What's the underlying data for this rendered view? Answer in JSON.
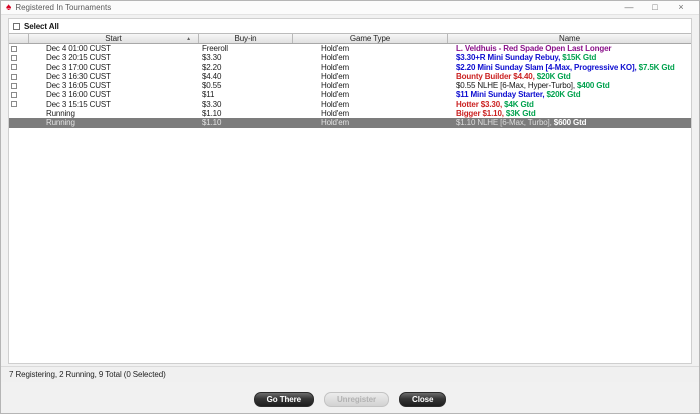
{
  "window": {
    "title": "Registered In Tournaments"
  },
  "titlebar": {
    "minimize_icon": "—",
    "maximize_icon": "□",
    "close_icon": "×",
    "app_icon": "red-spade"
  },
  "select_all": {
    "label": "Select All",
    "checked": false
  },
  "table": {
    "headers": {
      "checkbox": "",
      "start": "Start",
      "buyin": "Buy-in",
      "game_type": "Game Type",
      "name": "Name"
    },
    "sort_indicator": "▲",
    "rows": [
      {
        "checkbox": true,
        "selected": false,
        "start": "Dec 4 01:00 CUST",
        "buyin": "Freeroll",
        "game": "Hold'em",
        "name": [
          {
            "text": "L. Veldhuis - Red Spade Open Last Longer",
            "color": "purple",
            "bold": true
          }
        ]
      },
      {
        "checkbox": true,
        "selected": false,
        "start": "Dec 3 20:15 CUST",
        "buyin": "$3.30",
        "game": "Hold'em",
        "name": [
          {
            "text": "$3.30+R Mini Sunday Rebuy,",
            "color": "blue",
            "bold": true
          },
          {
            "text": " $15K Gtd",
            "color": "green",
            "bold": true
          }
        ]
      },
      {
        "checkbox": true,
        "selected": false,
        "start": "Dec 3 17:00 CUST",
        "buyin": "$2.20",
        "game": "Hold'em",
        "name": [
          {
            "text": "$2.20 Mini Sunday Slam [4-Max, Progressive KO],",
            "color": "blue",
            "bold": true
          },
          {
            "text": " $7.5K Gtd",
            "color": "green",
            "bold": true
          }
        ]
      },
      {
        "checkbox": true,
        "selected": false,
        "start": "Dec 3 16:30 CUST",
        "buyin": "$4.40",
        "game": "Hold'em",
        "name": [
          {
            "text": "Bounty Builder $4.40,",
            "color": "red",
            "bold": true
          },
          {
            "text": " $20K Gtd",
            "color": "green",
            "bold": true
          }
        ]
      },
      {
        "checkbox": true,
        "selected": false,
        "start": "Dec 3 16:05 CUST",
        "buyin": "$0.55",
        "game": "Hold'em",
        "name": [
          {
            "text": "$0.55 NLHE [6-Max, Hyper-Turbo],",
            "color": "black",
            "bold": false
          },
          {
            "text": " $400 Gtd",
            "color": "green",
            "bold": true
          }
        ]
      },
      {
        "checkbox": true,
        "selected": false,
        "start": "Dec 3 16:00 CUST",
        "buyin": "$11",
        "game": "Hold'em",
        "name": [
          {
            "text": "$11 Mini Sunday Starter,",
            "color": "blue",
            "bold": true
          },
          {
            "text": " $20K Gtd",
            "color": "green",
            "bold": true
          }
        ]
      },
      {
        "checkbox": true,
        "selected": false,
        "start": "Dec 3 15:15 CUST",
        "buyin": "$3.30",
        "game": "Hold'em",
        "name": [
          {
            "text": "Hotter $3.30,",
            "color": "red",
            "bold": true
          },
          {
            "text": " $4K Gtd",
            "color": "green",
            "bold": true
          }
        ]
      },
      {
        "checkbox": false,
        "selected": false,
        "start": "Running",
        "buyin": "$1.10",
        "game": "Hold'em",
        "name": [
          {
            "text": "Bigger $1.10,",
            "color": "red",
            "bold": true
          },
          {
            "text": " $3K Gtd",
            "color": "green",
            "bold": true
          }
        ]
      },
      {
        "checkbox": false,
        "selected": true,
        "start": "Running",
        "buyin": "$1.10",
        "game": "Hold'em",
        "name": [
          {
            "text": "$1.10 NLHE [6-Max, Turbo],",
            "color": "selected_text",
            "bold": false
          },
          {
            "text": " $600 Gtd",
            "color": "selected_bold",
            "bold": true
          }
        ]
      }
    ]
  },
  "status_bar": {
    "text": "7 Registering, 2 Running, 9 Total (0 Selected)"
  },
  "buttons": [
    {
      "label": "Go There",
      "enabled": true
    },
    {
      "label": "Unregister",
      "enabled": false
    },
    {
      "label": "Close",
      "enabled": true
    }
  ],
  "colors": {
    "purple": "#8a108a",
    "blue": "#0d0dd0",
    "red": "#cb2222",
    "green": "#00a24e",
    "black": "#161616",
    "selected_text": "#dcdcdc",
    "selected_bold": "#ffffff",
    "selected_bg": "#7c7c7c",
    "accent_red": "#d70022"
  }
}
